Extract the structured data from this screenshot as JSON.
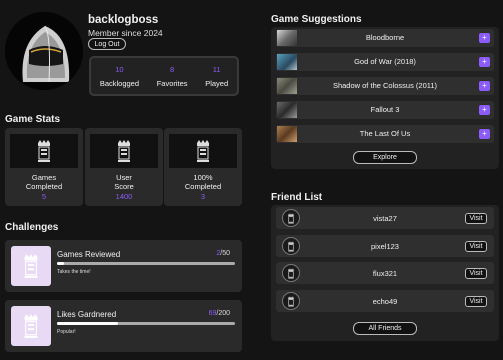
{
  "profile": {
    "username": "backlogboss",
    "member_since": "Member since 2024",
    "logout_label": "Log Out",
    "stats": [
      {
        "value": "10",
        "label": "Backlogged"
      },
      {
        "value": "8",
        "label": "Favorites"
      },
      {
        "value": "11",
        "label": "Played"
      }
    ]
  },
  "game_stats": {
    "title": "Game Stats",
    "cards": [
      {
        "line1": "Games",
        "line2": "Completed",
        "value": "5"
      },
      {
        "line1": "User",
        "line2": "Score",
        "value": "1400"
      },
      {
        "line1": "100%",
        "line2": "Completed",
        "value": "3"
      }
    ]
  },
  "challenges": {
    "title": "Challenges",
    "items": [
      {
        "title": "Games Reviewed",
        "current": "2",
        "total": "/50",
        "progress_percent": 4,
        "note": "Takes the time!"
      },
      {
        "title": "Likes Gardnered",
        "current": "69",
        "total": "/200",
        "progress_percent": 34.5,
        "note": "Popular!"
      }
    ]
  },
  "suggestions": {
    "title": "Game Suggestions",
    "games": [
      {
        "name": "Bloodborne"
      },
      {
        "name": "God of War (2018)"
      },
      {
        "name": "Shadow of the Colossus (2011)"
      },
      {
        "name": "Fallout 3"
      },
      {
        "name": "The Last Of Us"
      }
    ],
    "add_label": "+",
    "explore_label": "Explore"
  },
  "friends": {
    "title": "Friend List",
    "list": [
      {
        "name": "vista27"
      },
      {
        "name": "pixel123"
      },
      {
        "name": "flux321"
      },
      {
        "name": "echo49"
      }
    ],
    "visit_label": "Visit",
    "all_label": "All Friends"
  },
  "colors": {
    "accent": "#8b5cf6",
    "background": "#141414",
    "card": "#2a2a2a"
  }
}
